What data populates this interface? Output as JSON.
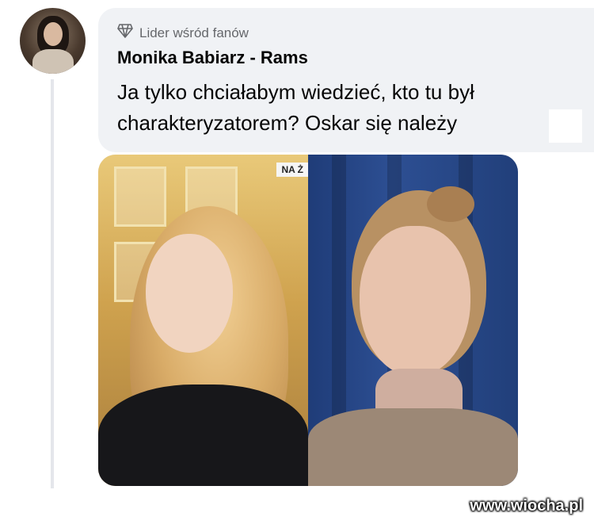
{
  "comment": {
    "badge_label": "Lider wśród fanów",
    "badge_icon": "diamond-icon",
    "author_name": "Monika Babiarz - Rams",
    "text": "Ja tylko chciałabym wiedzieć, kto tu był charakteryzatorem? Oskar się należy"
  },
  "photo": {
    "tv_caption": "NA Ż"
  },
  "watermark": {
    "text": "www.wiocha.pl"
  },
  "colors": {
    "bubble_bg": "#f0f2f5",
    "text_primary": "#050505",
    "text_secondary": "#65676b"
  }
}
